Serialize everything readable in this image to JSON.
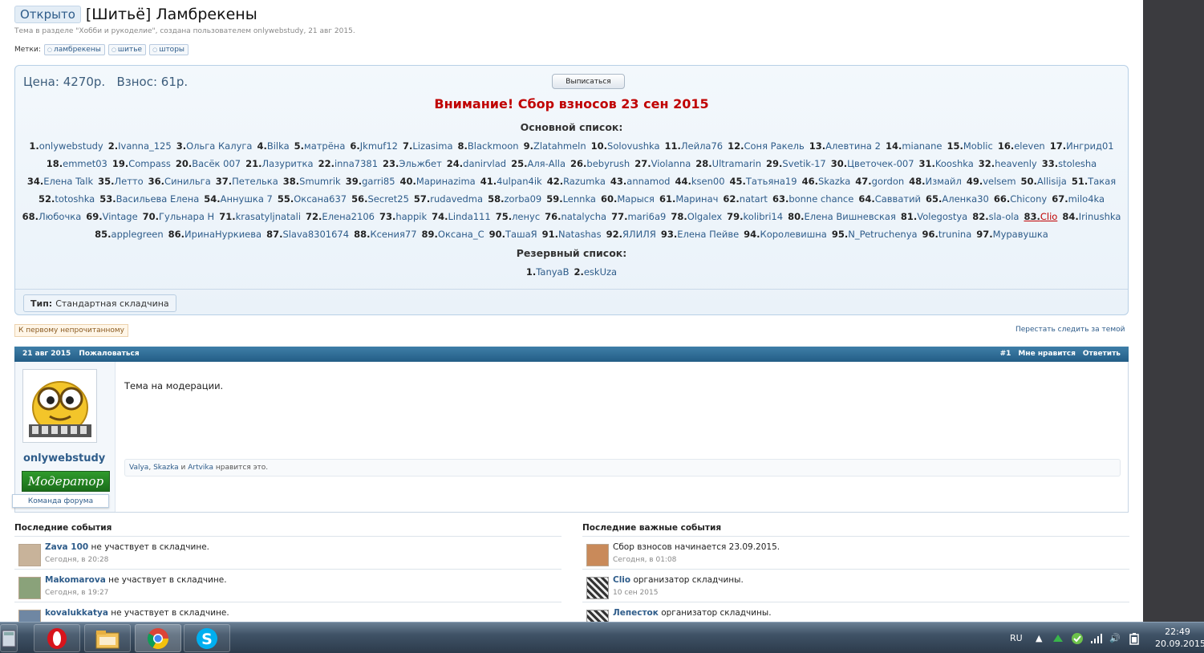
{
  "header": {
    "prefix": "Открыто",
    "title": "[Шитьё] Ламбрекены",
    "subtitle": "Тема в разделе \"Хобби и рукоделие\", создана пользователем onlywebstudy, 21 авг 2015.",
    "tags_label": "Метки:",
    "tags": [
      "ламбрекены",
      "шитье",
      "шторы"
    ]
  },
  "infobox": {
    "price": "Цена: 4270р.   Взнос: 61р.",
    "unsubscribe": "Выписаться",
    "warning": "Внимание! Сбор взносов 23 сен 2015",
    "main_title": "Основной список:",
    "main_lines": [
      [
        "1.",
        "onlywebstudy",
        "2.",
        "Ivanna_125",
        "3.",
        "Ольга Калуга",
        "4.",
        "Bilka",
        "5.",
        "матрёна",
        "6.",
        "Jkmuf12",
        "7.",
        "Lizasima",
        "8.",
        "Blackmoon",
        "9.",
        "Zlatahmeln",
        "10.",
        "Solovushka",
        "11.",
        "Лейла76",
        "12.",
        "Соня Ракель",
        "13.",
        "Алевтина 2",
        "14.",
        "mianane",
        "15.",
        "Moblic",
        "16.",
        "eleven",
        "17.",
        "Ингрид01"
      ],
      [
        "18.",
        "emmet03",
        "19.",
        "Compass",
        "20.",
        "Васёк 007",
        "21.",
        "Лазуритка",
        "22.",
        "inna7381",
        "23.",
        "Эльжбет",
        "24.",
        "danirvlad",
        "25.",
        "Аля-Alla",
        "26.",
        "bebyrush",
        "27.",
        "Violanna",
        "28.",
        "Ultramarin",
        "29.",
        "Svetik-17",
        "30.",
        "Цветочек-007",
        "31.",
        "Kooshka",
        "32.",
        "heavenly",
        "33.",
        "stolesha"
      ],
      [
        "34.",
        "Елена Talk",
        "35.",
        "Летто",
        "36.",
        "Синильга",
        "37.",
        "Петелька",
        "38.",
        "Smumrik",
        "39.",
        "garri85",
        "40.",
        "Маринаzima",
        "41.",
        "4ulpan4ik",
        "42.",
        "Razumka",
        "43.",
        "annamod",
        "44.",
        "ksen00",
        "45.",
        "Татьяна19",
        "46.",
        "Skazka",
        "47.",
        "gordon",
        "48.",
        "Измайл",
        "49.",
        "velsem",
        "50.",
        "Allisija",
        "51.",
        "Такая"
      ],
      [
        "52.",
        "totoshka",
        "53.",
        "Васильева Елена",
        "54.",
        "Аннушка 7",
        "55.",
        "Оксана637",
        "56.",
        "Secret25",
        "57.",
        "rudavedma",
        "58.",
        "zorba09",
        "59.",
        "Lennka",
        "60.",
        "Марыся",
        "61.",
        "Маринач",
        "62.",
        "natart",
        "63.",
        "bonne chance",
        "64.",
        "Савватий",
        "65.",
        "Аленка30",
        "66.",
        "Chicony",
        "67.",
        "milo4ka"
      ],
      [
        "68.",
        "Любочка",
        "69.",
        "Vintage",
        "70.",
        "Гульнара Н",
        "71.",
        "krasatyljnatali",
        "72.",
        "Елена2106",
        "73.",
        "happik",
        "74.",
        "Linda111",
        "75.",
        "ленус",
        "76.",
        "natalycha",
        "77.",
        "mari6a9",
        "78.",
        "Olgalex",
        "79.",
        "kolibri14",
        "80.",
        "Елена Вишневская",
        "81.",
        "Volegostya",
        "82.",
        "sla-ola",
        "83.",
        "Clio",
        "84.",
        "Irinushka"
      ],
      [
        "85.",
        "applegreen",
        "86.",
        "ИринаНуркиева",
        "87.",
        "Slava8301674",
        "88.",
        "Ксения77",
        "89.",
        "Оксана_С",
        "90.",
        "ТашаЯ",
        "91.",
        "Natashas",
        "92.",
        "ЯЛИЛЯ",
        "93.",
        "Елена Пейве",
        "94.",
        "Королевишна",
        "95.",
        "N_Petruchenya",
        "96.",
        "trunina",
        "97.",
        "Муравушка"
      ]
    ],
    "reserve_title": "Резервный список:",
    "reserve_line": [
      "1.",
      "TanyaB",
      "2.",
      "eskUza"
    ],
    "type_label": "Тип:",
    "type_value": "Стандартная складчина"
  },
  "nav": {
    "first_unread": "К первому непрочитанному",
    "stop_watch": "Перестать следить за темой"
  },
  "post": {
    "date": "21 авг 2015",
    "report": "Пожаловаться",
    "number": "#1",
    "like": "Мне нравится",
    "reply": "Ответить",
    "username": "onlywebstudy",
    "role": "Модератор",
    "team": "Команда форума",
    "body": "Тема на модерации.",
    "likes": {
      "u1": "Valya",
      "sep1": ", ",
      "u2": "Skazka",
      "sep2": " и ",
      "u3": "Artvika",
      "suffix": " нравится это."
    }
  },
  "events_left": {
    "title": "Последние события",
    "items": [
      {
        "who": "Zava 100",
        "text": " не участвует в складчине.",
        "time": "Сегодня, в 20:28"
      },
      {
        "who": "Makomarova",
        "text": " не участвует в складчине.",
        "time": "Сегодня, в 19:27"
      },
      {
        "who": "kovalukkatya",
        "text": " не участвует в складчине.",
        "time": ""
      }
    ]
  },
  "events_right": {
    "title": "Последние важные события",
    "items": [
      {
        "who": "",
        "text": "Сбор взносов начинается 23.09.2015.",
        "time": "Сегодня, в 01:08"
      },
      {
        "who": "Clio",
        "text": " организатор складчины.",
        "time": "10 сен 2015"
      },
      {
        "who": "Лепесток",
        "text": " организатор складчины.",
        "time": ""
      }
    ]
  },
  "taskbar": {
    "lang": "RU",
    "time": "22:49",
    "date": "20.09.2015"
  }
}
